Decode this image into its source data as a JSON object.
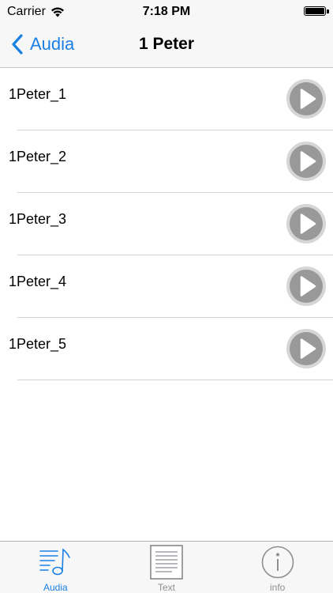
{
  "status_bar": {
    "carrier": "Carrier",
    "time": "7:18 PM",
    "battery_level": 1.0
  },
  "nav_bar": {
    "back_label": "Audia",
    "title": "1 Peter"
  },
  "list": {
    "items": [
      {
        "label": "1Peter_1"
      },
      {
        "label": "1Peter_2"
      },
      {
        "label": "1Peter_3"
      },
      {
        "label": "1Peter_4"
      },
      {
        "label": "1Peter_5"
      }
    ]
  },
  "tab_bar": {
    "tabs": [
      {
        "label": "Audia",
        "icon": "music-list-icon",
        "active": true
      },
      {
        "label": "Text",
        "icon": "document-icon",
        "active": false
      },
      {
        "label": "info",
        "icon": "info-icon",
        "active": false
      }
    ]
  },
  "colors": {
    "accent": "#1a80e6",
    "inactive": "#8e8e93",
    "bar_background": "#f7f7f7",
    "play_button": "#999999"
  }
}
